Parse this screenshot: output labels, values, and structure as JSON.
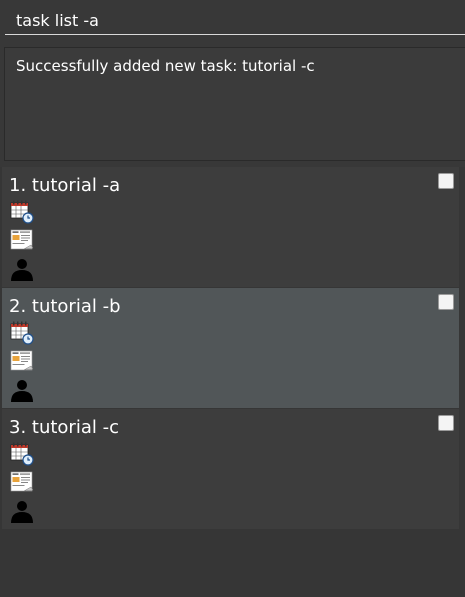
{
  "command": {
    "value": "task list -a"
  },
  "result": {
    "message": "Successfully added new task: tutorial -c"
  },
  "tasks": [
    {
      "title": "1. tutorial -a",
      "done": false
    },
    {
      "title": "2. tutorial -b",
      "done": false
    },
    {
      "title": "3. tutorial -c",
      "done": false
    }
  ],
  "icons": {
    "schedule": "calendar-clock-icon",
    "details": "document-icon",
    "person": "person-icon"
  },
  "colors": {
    "background": "#383838",
    "card": "#3d3d3d",
    "card_alt": "#515658",
    "text": "#ffffff"
  }
}
